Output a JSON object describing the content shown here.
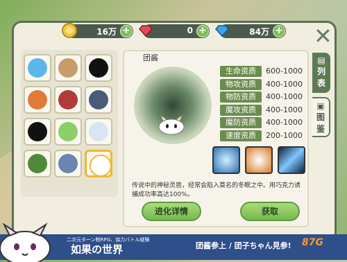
{
  "resources": [
    {
      "icon": "coin-icon",
      "value": "16万",
      "color": "#f5c73a"
    },
    {
      "icon": "ruby-icon",
      "value": "0",
      "color": "#e24a5a"
    },
    {
      "icon": "diamond-icon",
      "value": "84万",
      "color": "#3aa4e6"
    }
  ],
  "detail": {
    "title": "团酱",
    "stats": [
      {
        "label": "生命资质",
        "value": "600-1000"
      },
      {
        "label": "物攻资质",
        "value": "400-1000"
      },
      {
        "label": "物防资质",
        "value": "400-1000"
      },
      {
        "label": "魔攻资质",
        "value": "400-1000"
      },
      {
        "label": "魔防资质",
        "value": "400-1000"
      },
      {
        "label": "速度资质",
        "value": "200-1000"
      }
    ],
    "description": "传说中的神秘灵兽，经常会陷入莫名的冬眠之中。用巧克力诱捕成功率高达100%。",
    "evolve_button": "进化详情",
    "obtain_button": "获取"
  },
  "tabs": [
    {
      "label_1": "列",
      "label_2": "表"
    },
    {
      "label_1": "图",
      "label_2": "鉴"
    }
  ],
  "banner": {
    "subtitle": "二次元ターン制RPG、協力バトル疑験",
    "title": "如果の世界",
    "right_text": "团酱参上 / 团子ちゃん見参!",
    "logo": "87G"
  }
}
